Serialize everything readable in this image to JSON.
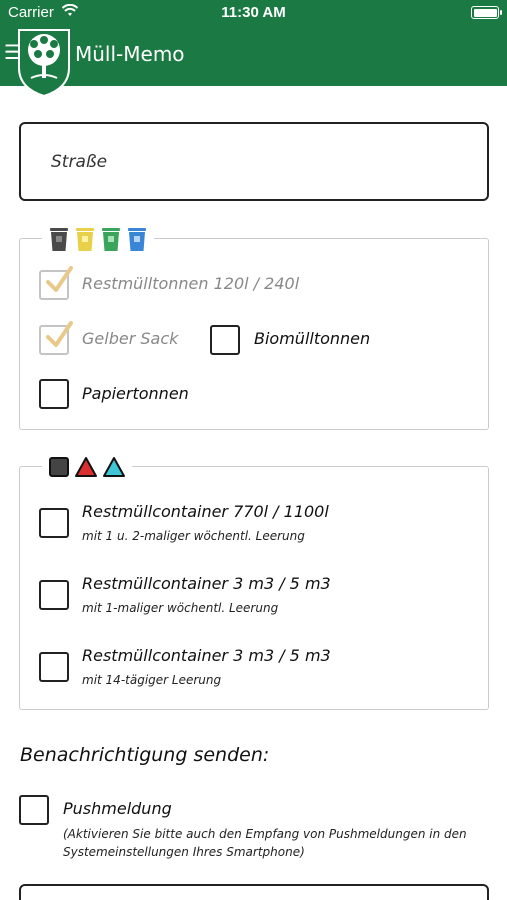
{
  "status_bar": {
    "carrier": "Carrier",
    "time": "11:30 AM",
    "wifi_icon": "wifi-icon",
    "battery_icon": "battery-icon"
  },
  "nav": {
    "title": "Müll-Memo",
    "menu_icon": "hamburger-menu-icon",
    "logo_icon": "tree-crest-icon"
  },
  "street": {
    "placeholder": "Straße",
    "value": ""
  },
  "household_bins": {
    "legend_icons": [
      "gray-bin-icon",
      "yellow-bin-icon",
      "green-bin-icon",
      "blue-bin-icon"
    ],
    "items": [
      {
        "label": "Restmülltonnen 120l / 240l",
        "checked": true
      },
      {
        "label": "Gelber Sack",
        "checked": true
      },
      {
        "label": "Biomülltonnen",
        "checked": false
      },
      {
        "label": "Papiertonnen",
        "checked": false
      }
    ]
  },
  "containers": {
    "legend_icons": [
      "black-square-icon",
      "red-triangle-icon",
      "cyan-triangle-icon"
    ],
    "items": [
      {
        "label": "Restmüllcontainer 770l / 1100l",
        "sub": "mit 1 u. 2-maliger wöchentl. Leerung",
        "checked": false
      },
      {
        "label": "Restmüllcontainer 3 m3 / 5 m3",
        "sub": "mit 1-maliger wöchentl. Leerung",
        "checked": false
      },
      {
        "label": "Restmüllcontainer 3 m3 / 5 m3",
        "sub": "mit 14-tägiger Leerung",
        "checked": false
      }
    ]
  },
  "notifications": {
    "title": "Benachrichtigung senden:",
    "push_label": "Pushmeldung",
    "push_checked": false,
    "note": "(Aktivieren Sie bitte auch den Empfang von Pushmeldungen in den Systemeinstellungen Ihres Smartphone)"
  },
  "colors": {
    "brand_green": "#1b7a43",
    "gray_bin": "#4a4a4a",
    "yellow_bin": "#e8d04a",
    "green_bin": "#3aa55a",
    "blue_bin": "#3a86d6",
    "red_triangle": "#d9302f",
    "cyan_triangle": "#3ec6d6"
  }
}
